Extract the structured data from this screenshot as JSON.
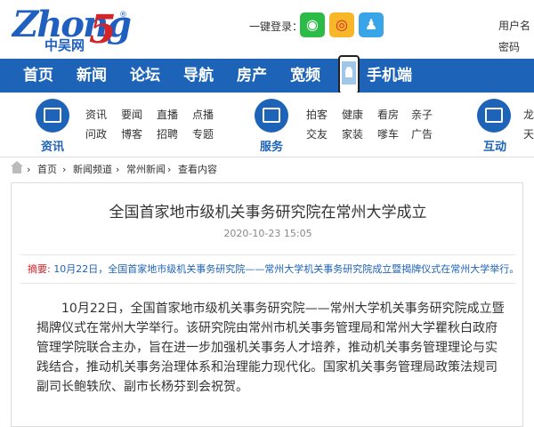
{
  "header": {
    "logo": {
      "word": "Zhong",
      "five": "5",
      "reg": "®",
      "cn": "中吴网"
    },
    "login_label": "一键登录：",
    "social": [
      "wechat-icon",
      "weibo-icon",
      "qq-icon"
    ],
    "username_label": "用户名",
    "password_label": "密码"
  },
  "nav": {
    "items": [
      "首页",
      "新闻",
      "论坛",
      "导航",
      "房产",
      "宽频",
      "手机端"
    ]
  },
  "services": {
    "groups": [
      {
        "label": "资讯",
        "links": [
          "资讯",
          "要闻",
          "直播",
          "点播",
          "问政",
          "博客",
          "招聘",
          "专题"
        ]
      },
      {
        "label": "服务",
        "links": [
          "拍客",
          "健康",
          "看房",
          "亲子",
          "交友",
          "家装",
          "嗲车",
          "广告"
        ]
      },
      {
        "label": "互动",
        "links": [
          "龙",
          "天"
        ]
      }
    ]
  },
  "breadcrumb": [
    "首页",
    "新闻频道",
    "常州新闻",
    "查看内容"
  ],
  "article": {
    "title": "全国首家地市级机关事务研究院在常州大学成立",
    "date": "2020-10-23 15:05",
    "summary_label": "摘要:",
    "summary": "10月22日，全国首家地市级机关事务研究院——常州大学机关事务研究院成立暨揭牌仪式在常州大学举行。",
    "body": "10月22日，全国首家地市级机关事务研究院——常州大学机关事务研究院成立暨揭牌仪式在常州大学举行。该研究院由常州市机关事务管理局和常州大学瞿秋白政府管理学院联合主办，旨在进一步加强机关事务人才培养，推动机关事务管理理论与实践结合，推动机关事务治理体系和治理能力现代化。国家机关事务管理局政策法规司副司长鲍轶欣、副市长杨芬到会祝贺。"
  },
  "colors": {
    "brand_blue": "#1d63b8",
    "accent_red": "#d4252b"
  }
}
